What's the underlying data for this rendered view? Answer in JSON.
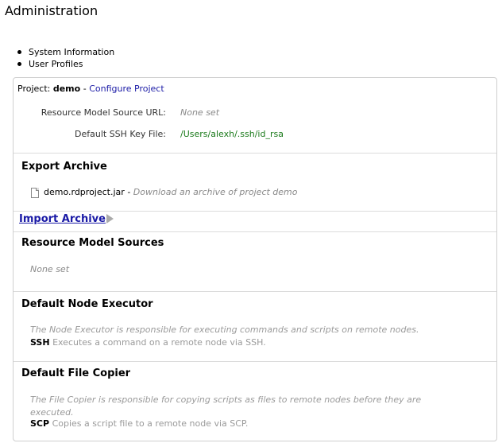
{
  "page": {
    "title": "Administration"
  },
  "nav": {
    "items": [
      {
        "label": "System Information"
      },
      {
        "label": "User Profiles"
      }
    ]
  },
  "project": {
    "label": "Project:",
    "name": "demo",
    "separator": "-",
    "configure_link": "Configure Project",
    "resource_url_label": "Resource Model Source URL:",
    "resource_url_value": "None set",
    "ssh_key_label": "Default SSH Key File:",
    "ssh_key_value": "/Users/alexh/.ssh/id_rsa"
  },
  "export": {
    "title": "Export Archive",
    "file_name": "demo.rdproject.jar",
    "separator": "-",
    "description": "Download an archive of project demo"
  },
  "import": {
    "link": "Import Archive"
  },
  "resource_sources": {
    "title": "Resource Model Sources",
    "value": "None set"
  },
  "node_executor": {
    "title": "Default Node Executor",
    "description": "The Node Executor is responsible for executing commands and scripts on remote nodes.",
    "code": "SSH",
    "code_description": "Executes a command on a remote node via SSH."
  },
  "file_copier": {
    "title": "Default File Copier",
    "description": "The File Copier is responsible for copying scripts as files to remote nodes before they are executed.",
    "code": "SCP",
    "code_description": "Copies a script file to a remote node via SCP."
  },
  "colors": {
    "link": "#1a1aa6",
    "muted": "#8a8a8a",
    "path": "#1a7a1a",
    "border": "#cfcfcf"
  }
}
